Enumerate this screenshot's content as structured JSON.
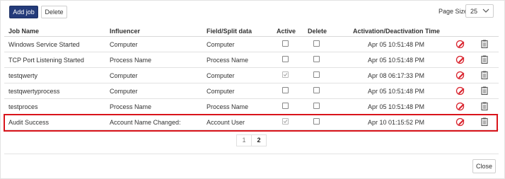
{
  "toolbar": {
    "add_label": "Add job",
    "delete_label": "Delete"
  },
  "page_size": {
    "label": "Page Size",
    "value": "25"
  },
  "columns": [
    "Job Name",
    "Influencer",
    "Field/Split data",
    "Active",
    "Delete",
    "Activation/Deactivation Time"
  ],
  "rows": [
    {
      "job_name": "Windows Service Started",
      "influencer": "Computer",
      "field": "Computer",
      "active": false,
      "delete": false,
      "time": "Apr 05 10:51:48 PM"
    },
    {
      "job_name": "TCP Port Listening Started",
      "influencer": "Process Name",
      "field": "Process Name",
      "active": false,
      "delete": false,
      "time": "Apr 05 10:51:48 PM"
    },
    {
      "job_name": "testqwerty",
      "influencer": "Computer",
      "field": "Computer",
      "active": true,
      "delete": false,
      "time": "Apr 08 06:17:33 PM"
    },
    {
      "job_name": "testqwertyprocess",
      "influencer": "Computer",
      "field": "Computer",
      "active": false,
      "delete": false,
      "time": "Apr 05 10:51:48 PM"
    },
    {
      "job_name": "testproces",
      "influencer": "Process Name",
      "field": "Process Name",
      "active": false,
      "delete": false,
      "time": "Apr 05 10:51:48 PM"
    },
    {
      "job_name": "Audit Success",
      "influencer": "Account Name Changed:",
      "field": "Account User",
      "active": true,
      "delete": false,
      "time": "Apr 10 01:15:52 PM"
    }
  ],
  "highlighted_row": 5,
  "pagination": {
    "pages": [
      "1",
      "2"
    ],
    "current": "2"
  },
  "footer": {
    "close_label": "Close"
  },
  "icons": {
    "edit": "edit-pencil-icon",
    "details": "clipboard-icon"
  },
  "colors": {
    "primary": "#243b7a",
    "highlight": "#d9141b",
    "edit_icon": "#d9232d"
  }
}
